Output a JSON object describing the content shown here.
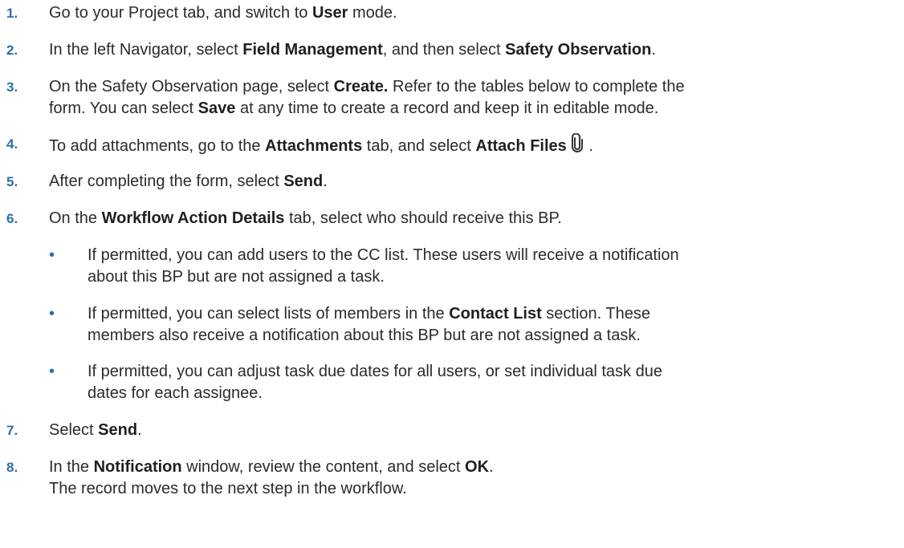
{
  "steps": [
    {
      "num": "1.",
      "lines": [
        [
          "Go to your Project tab, and switch to ",
          "User",
          " mode."
        ]
      ]
    },
    {
      "num": "2.",
      "lines": [
        [
          "In the left Navigator, select ",
          "Field Management",
          ", and then select ",
          "Safety Observation",
          "."
        ]
      ]
    },
    {
      "num": "3.",
      "lines": [
        [
          "On the Safety Observation page, select ",
          "Create.",
          " Refer to the tables below to complete the"
        ],
        [
          "form. You can select ",
          "Save",
          " at any time to create a record and keep it in editable mode."
        ]
      ]
    },
    {
      "num": "4.",
      "lines": [
        [
          "To add attachments, go to the ",
          "Attachments",
          " tab, and select ",
          "Attach Files",
          "."
        ]
      ],
      "icon": "paperclip-icon"
    },
    {
      "num": "5.",
      "lines": [
        [
          "After completing the form, select ",
          "Send",
          "."
        ]
      ]
    },
    {
      "num": "6.",
      "lines": [
        [
          "On the ",
          "Workflow Action Details",
          " tab, select who should receive this BP."
        ]
      ]
    },
    {
      "num": "7.",
      "lines": [
        [
          "Select ",
          "Send",
          "."
        ]
      ]
    },
    {
      "num": "8.",
      "lines": [
        [
          "In the ",
          "Notification",
          " window, review the content, and select ",
          "OK",
          "."
        ],
        [
          "The record moves to the next step in the workflow."
        ]
      ]
    }
  ],
  "bullets": [
    {
      "symbol": "•",
      "lines": [
        [
          "If permitted, you can add users to the CC list. These users will receive a notification"
        ],
        [
          "about this BP but are not assigned a task."
        ]
      ]
    },
    {
      "symbol": "•",
      "lines": [
        [
          "If permitted, you can select lists of members in the ",
          "Contact List",
          " section. These"
        ],
        [
          "members also receive a notification about this BP but are not assigned a task."
        ]
      ]
    },
    {
      "symbol": "•",
      "lines": [
        [
          "If permitted, you can adjust task due dates for all users, or set individual task due"
        ],
        [
          "dates for each assignee."
        ]
      ]
    }
  ],
  "colors": {
    "number": "#2d6fa7",
    "text": "#2b2b2b"
  }
}
